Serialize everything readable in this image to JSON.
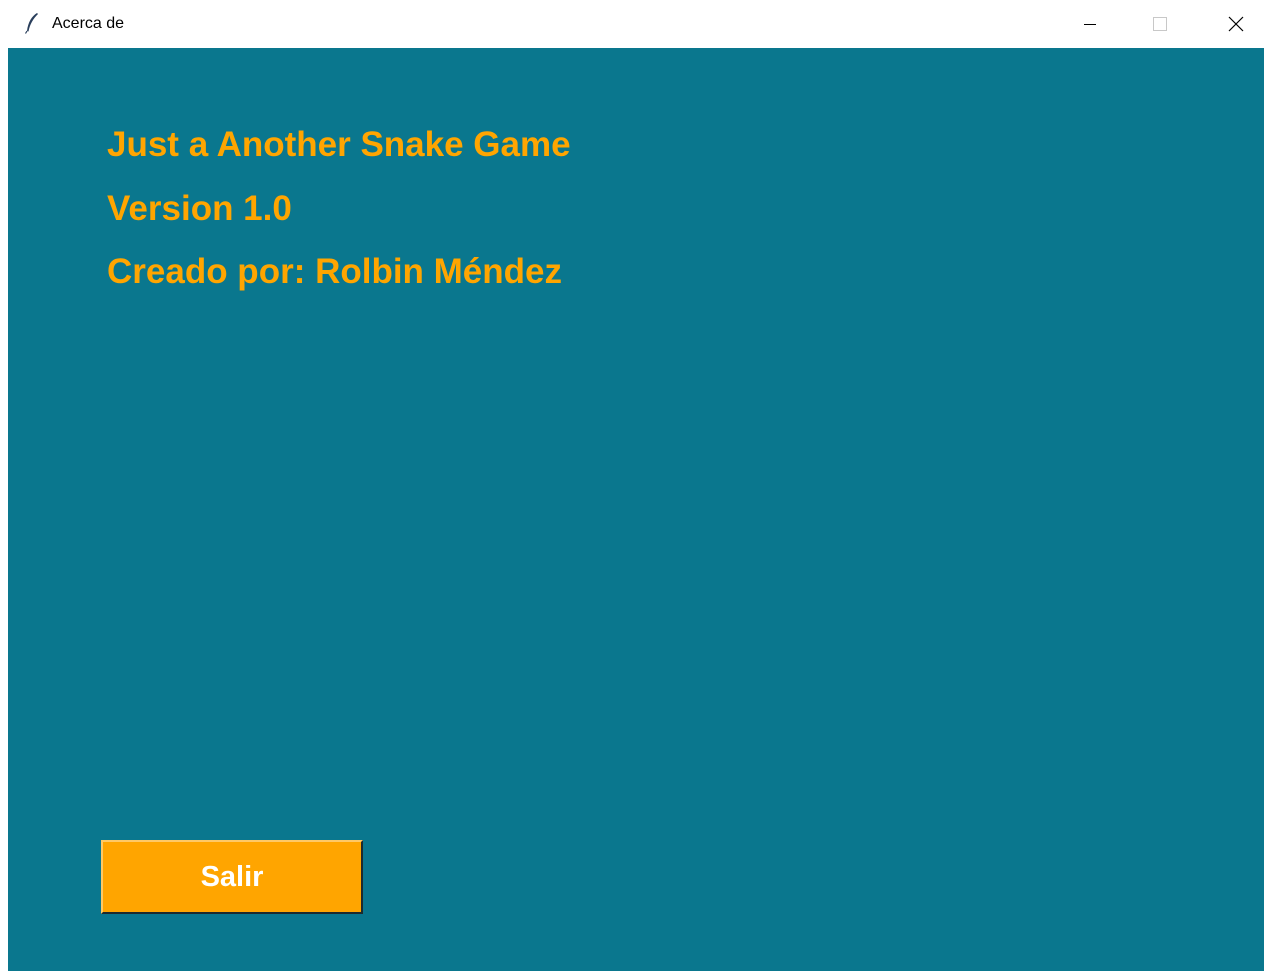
{
  "window": {
    "title": "Acerca de",
    "icon": "feather-icon",
    "controls": {
      "minimize": "minimize-icon",
      "maximize": "maximize-icon",
      "close": "close-icon"
    }
  },
  "content": {
    "background_color": "#0a778e",
    "text_color": "#ffa500",
    "lines": [
      "Just a Another Snake Game",
      "Version 1.0",
      "Creado por: Rolbin Méndez"
    ],
    "exit_button": {
      "label": "Salir",
      "background_color": "#ffa500",
      "text_color": "#ffffff"
    }
  }
}
